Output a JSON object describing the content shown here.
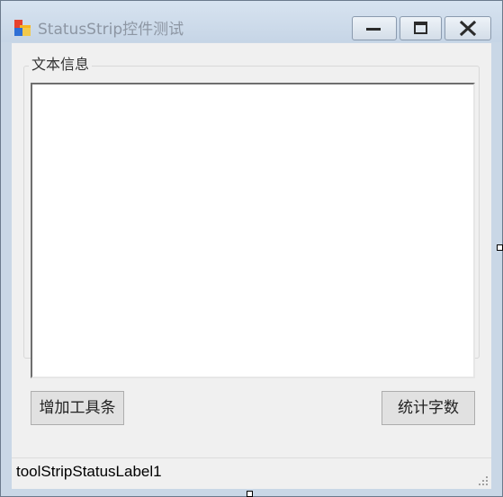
{
  "window": {
    "title": "StatusStrip控件测试"
  },
  "title_bar": {
    "icon": "windows-forms-app-icon",
    "buttons": {
      "minimize_icon": "minimize-icon",
      "maximize_icon": "maximize-icon",
      "close_icon": "close-icon"
    }
  },
  "group": {
    "legend": "文本信息"
  },
  "textbox": {
    "value": ""
  },
  "buttons": {
    "add_toolbar": "增加工具条",
    "count_chars": "统计字数"
  },
  "status_strip": {
    "label": "toolStripStatusLabel1",
    "grip_icon": "resize-grip-icon"
  },
  "colors": {
    "title_text": "#8d96a3",
    "client_background": "#f0f0f0",
    "frame": "#c9d7e6"
  }
}
